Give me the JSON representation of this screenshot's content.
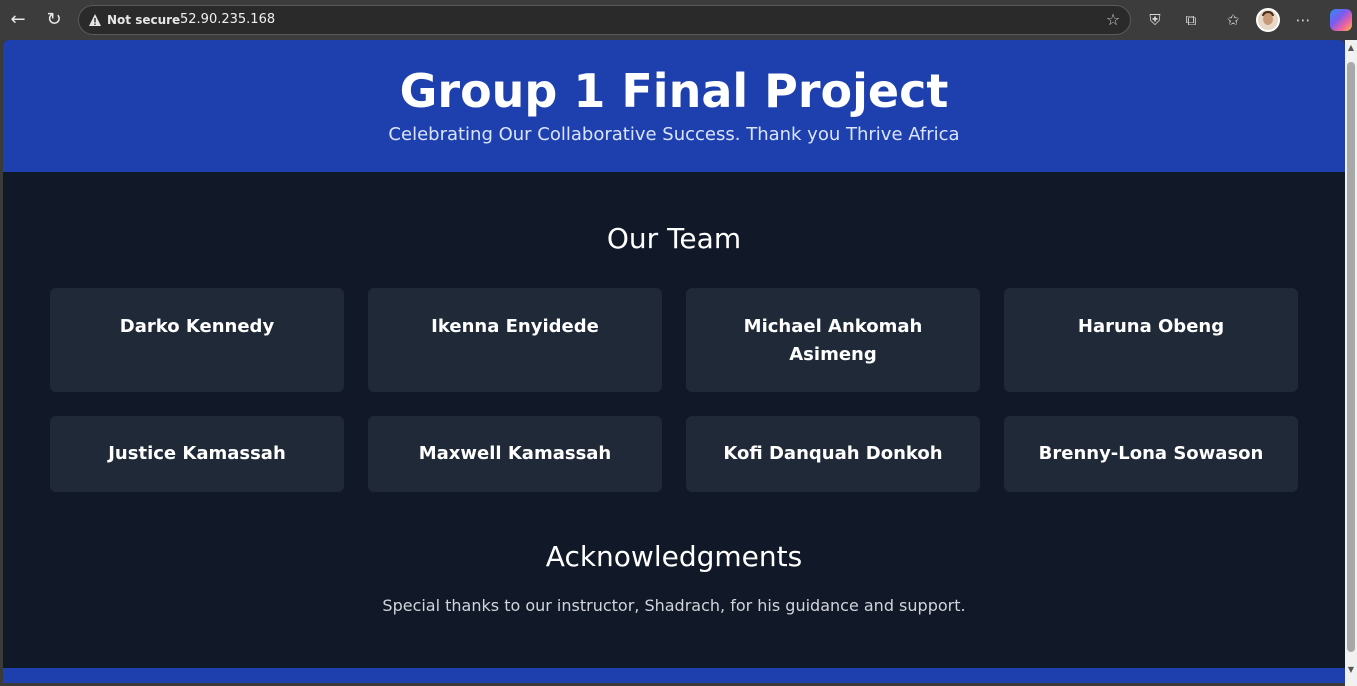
{
  "browser": {
    "security_label": "Not secure",
    "url": "52.90.235.168",
    "icons": [
      "back-icon",
      "reload-icon",
      "warning-icon",
      "star-icon",
      "shield-icon",
      "extensions-icon",
      "favorites-icon",
      "avatar",
      "more-icon",
      "copilot-icon"
    ],
    "glyphs": {
      "back": "←",
      "reload": "↻",
      "star": "☆",
      "shield": "⛨",
      "extensions": "⧉",
      "favorites": "✩",
      "more": "⋯",
      "scroll_up": "▲",
      "scroll_down": "▼"
    }
  },
  "header": {
    "title": "Group 1 Final Project",
    "subtitle": "Celebrating Our Collaborative Success. Thank you Thrive Africa"
  },
  "team": {
    "heading": "Our Team",
    "members": [
      "Darko Kennedy",
      "Ikenna Enyidede",
      "Michael Ankomah Asimeng",
      "Haruna Obeng",
      "Justice Kamassah",
      "Maxwell Kamassah",
      "Kofi Danquah Donkoh",
      "Brenny-Lona Sowason"
    ]
  },
  "acknowledgments": {
    "heading": "Acknowledgments",
    "text": "Special thanks to our instructor, Shadrach, for his guidance and support."
  },
  "colors": {
    "header_bg": "#1e40af",
    "page_bg": "#111827",
    "card_bg": "#1f2937"
  }
}
